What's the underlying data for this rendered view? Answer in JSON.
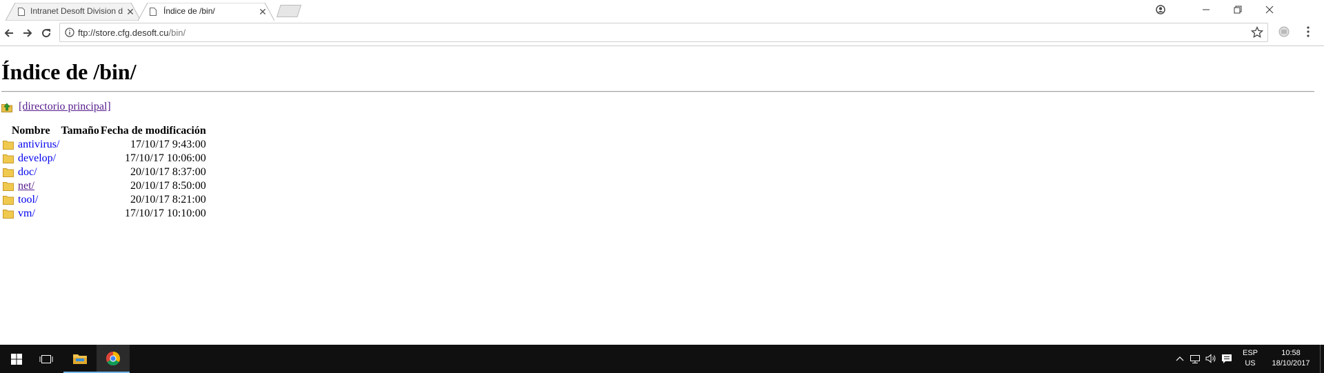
{
  "tabs": [
    {
      "title": "Intranet Desoft Division d",
      "active": false
    },
    {
      "title": "Índice de /bin/",
      "active": true
    }
  ],
  "window_controls": {
    "account": "account-icon",
    "minimize": "minimize-icon",
    "restore": "restore-icon",
    "close": "close-icon"
  },
  "toolbar": {
    "url_host": "ftp://store.cfg.desoft.cu",
    "url_path": "/bin/"
  },
  "page": {
    "title": "Índice de /bin/",
    "parent_link": "[directorio principal]",
    "columns": {
      "name": "Nombre",
      "size": "Tamaño",
      "date": "Fecha de modificación"
    },
    "rows": [
      {
        "name": "antivirus/",
        "size": "",
        "date": "17/10/17 9:43:00"
      },
      {
        "name": "develop/",
        "size": "",
        "date": "17/10/17 10:06:00"
      },
      {
        "name": "doc/",
        "size": "",
        "date": "20/10/17 8:37:00"
      },
      {
        "name": "net/",
        "size": "",
        "date": "20/10/17 8:50:00"
      },
      {
        "name": "tool/",
        "size": "",
        "date": "20/10/17 8:21:00"
      },
      {
        "name": "vm/",
        "size": "",
        "date": "17/10/17 10:10:00"
      }
    ]
  },
  "taskbar": {
    "language": "ESP",
    "layout": "US",
    "time": "10:58",
    "date": "18/10/2017"
  },
  "colors": {
    "link": "#0000ee",
    "visited": "#551a8b",
    "taskbar": "#101010",
    "accent": "#76b9ed"
  }
}
